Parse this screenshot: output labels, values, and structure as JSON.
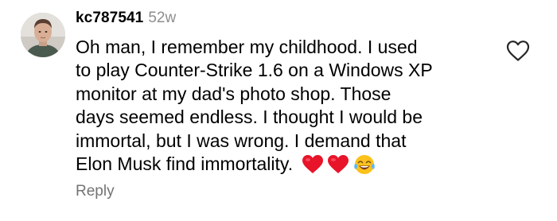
{
  "comment": {
    "username": "kc787541",
    "age": "52w",
    "lines": [
      "Oh man, I remember my childhood. I used",
      "to play Counter-Strike 1.6 on a Windows XP",
      "monitor at my dad's photo shop. Those",
      "days seemed endless. I thought I would be",
      "immortal, but I was wrong. I demand that",
      "Elon Musk find immortality."
    ],
    "emojis": [
      "red-heart",
      "red-heart",
      "face-with-tears-of-joy"
    ],
    "reply_label": "Reply",
    "like_icon": "heart-outline-icon"
  },
  "colors": {
    "text": "#000000",
    "muted": "#8e8e8e",
    "reply": "#737373",
    "heart": "#e8142a"
  }
}
